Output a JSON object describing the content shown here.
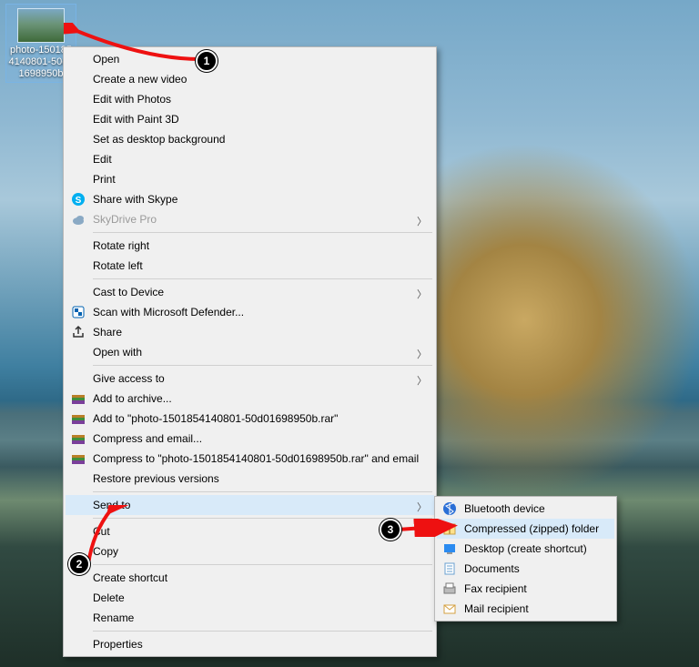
{
  "file": {
    "name": "photo-1501854140801-50d01698950b"
  },
  "menu": {
    "open": "Open",
    "new_video": "Create a new video",
    "edit_photos": "Edit with Photos",
    "edit_paint3d": "Edit with Paint 3D",
    "set_bg": "Set as desktop background",
    "edit": "Edit",
    "print": "Print",
    "skype": "Share with Skype",
    "skydrive": "SkyDrive Pro",
    "rotate_right": "Rotate right",
    "rotate_left": "Rotate left",
    "cast": "Cast to Device",
    "defender": "Scan with Microsoft Defender...",
    "share": "Share",
    "open_with": "Open with",
    "give_access": "Give access to",
    "rar_add": "Add to archive...",
    "rar_add_to": "Add to \"photo-1501854140801-50d01698950b.rar\"",
    "rar_email": "Compress and email...",
    "rar_comp_email": "Compress to \"photo-1501854140801-50d01698950b.rar\" and email",
    "restore": "Restore previous versions",
    "send_to": "Send to",
    "cut": "Cut",
    "copy": "Copy",
    "create_shortcut": "Create shortcut",
    "delete": "Delete",
    "rename": "Rename",
    "properties": "Properties"
  },
  "sendto": {
    "bluetooth": "Bluetooth device",
    "zip": "Compressed (zipped) folder",
    "desktop": "Desktop (create shortcut)",
    "documents": "Documents",
    "fax": "Fax recipient",
    "mail": "Mail recipient"
  },
  "callouts": {
    "c1": "1",
    "c2": "2",
    "c3": "3"
  }
}
